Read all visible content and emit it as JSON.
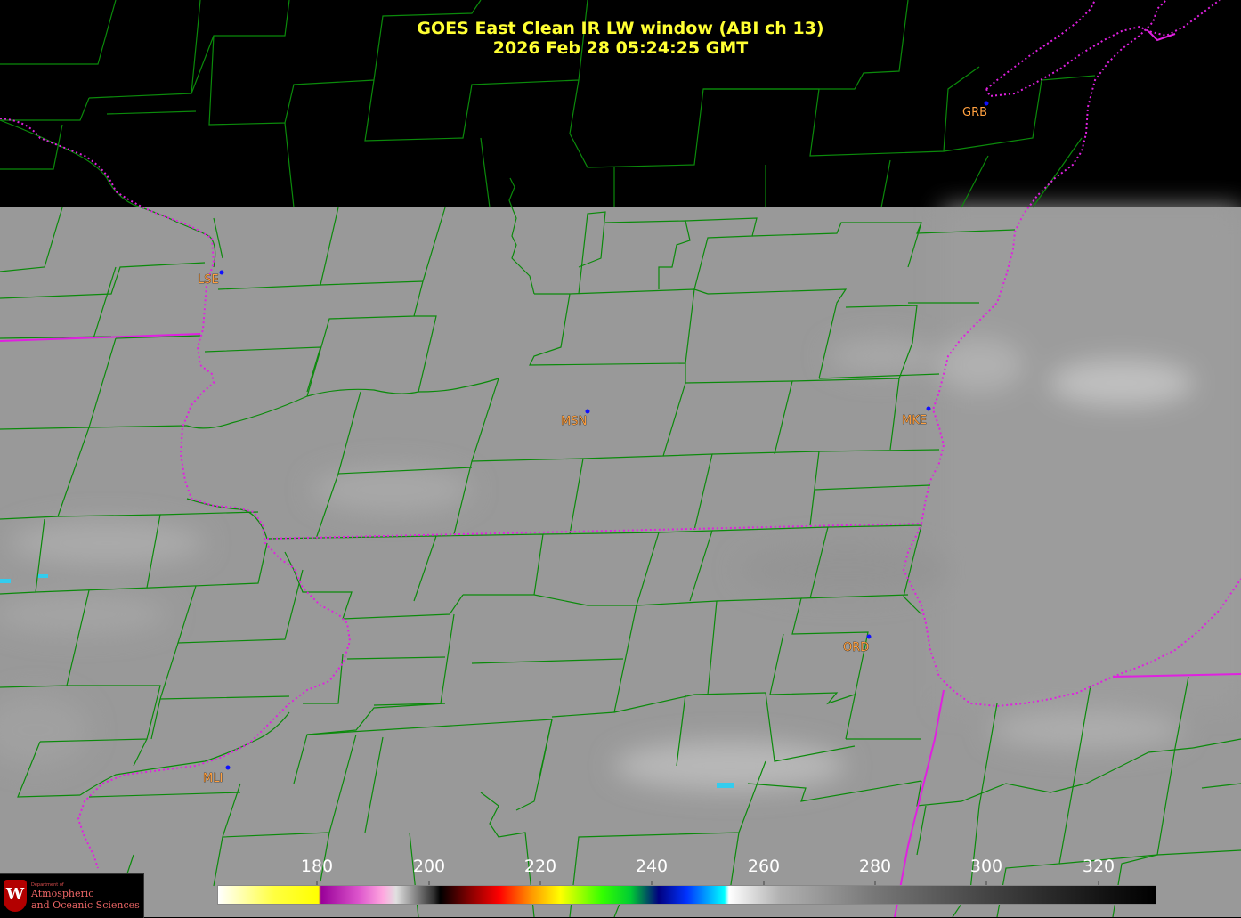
{
  "title": {
    "line1": "GOES East Clean IR LW window (ABI ch 13)",
    "line2": "2026 Feb 28  05:24:25 GMT"
  },
  "stations": [
    {
      "id": "GRB"
    },
    {
      "id": "LSE"
    },
    {
      "id": "MSN"
    },
    {
      "id": "MKE"
    },
    {
      "id": "ORD"
    },
    {
      "id": "MLI"
    }
  ],
  "colorbar": {
    "ticks": [
      "180",
      "200",
      "220",
      "240",
      "260",
      "280",
      "300",
      "320"
    ]
  },
  "logo": {
    "crest": "W",
    "dept": "Department of",
    "line1": "Atmospheric",
    "line2": "and Oceanic Sciences"
  },
  "colors": {
    "title": "#ffff33",
    "county_lines": "#0b8a0b",
    "state_lines": "#e020e0",
    "station_label": "#ffa040",
    "station_dot": "#1010ff",
    "cloud_gray": "#999999",
    "no_data": "#000000"
  }
}
